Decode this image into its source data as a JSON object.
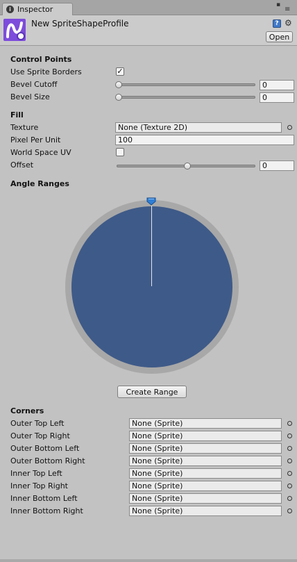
{
  "window": {
    "tab_label": "Inspector"
  },
  "header": {
    "asset_name": "New SpriteShapeProfile",
    "open_label": "Open"
  },
  "control_points": {
    "title": "Control Points",
    "use_sprite_borders": {
      "label": "Use Sprite Borders",
      "checked": true,
      "mark": "✓"
    },
    "bevel_cutoff": {
      "label": "Bevel Cutoff",
      "value": "0",
      "fraction": 0.0
    },
    "bevel_size": {
      "label": "Bevel Size",
      "value": "0",
      "fraction": 0.0
    }
  },
  "fill": {
    "title": "Fill",
    "texture": {
      "label": "Texture",
      "value": "None (Texture 2D)"
    },
    "pixel_per_unit": {
      "label": "Pixel Per Unit",
      "value": "100"
    },
    "world_space_uv": {
      "label": "World Space UV",
      "checked": false
    },
    "offset": {
      "label": "Offset",
      "value": "0",
      "fraction": 0.5
    }
  },
  "angle_ranges": {
    "title": "Angle Ranges",
    "colors": {
      "disc": "#3e5a88",
      "ring": "#a8a8a8",
      "handle": "#2f7fd6"
    },
    "create_range_label": "Create Range"
  },
  "corners": {
    "title": "Corners",
    "items": [
      {
        "label": "Outer Top Left",
        "value": "None (Sprite)"
      },
      {
        "label": "Outer Top Right",
        "value": "None (Sprite)"
      },
      {
        "label": "Outer Bottom Left",
        "value": "None (Sprite)"
      },
      {
        "label": "Outer Bottom Right",
        "value": "None (Sprite)"
      },
      {
        "label": "Inner Top Left",
        "value": "None (Sprite)"
      },
      {
        "label": "Inner Top Right",
        "value": "None (Sprite)"
      },
      {
        "label": "Inner Bottom Left",
        "value": "None (Sprite)"
      },
      {
        "label": "Inner Bottom Right",
        "value": "None (Sprite)"
      }
    ]
  }
}
